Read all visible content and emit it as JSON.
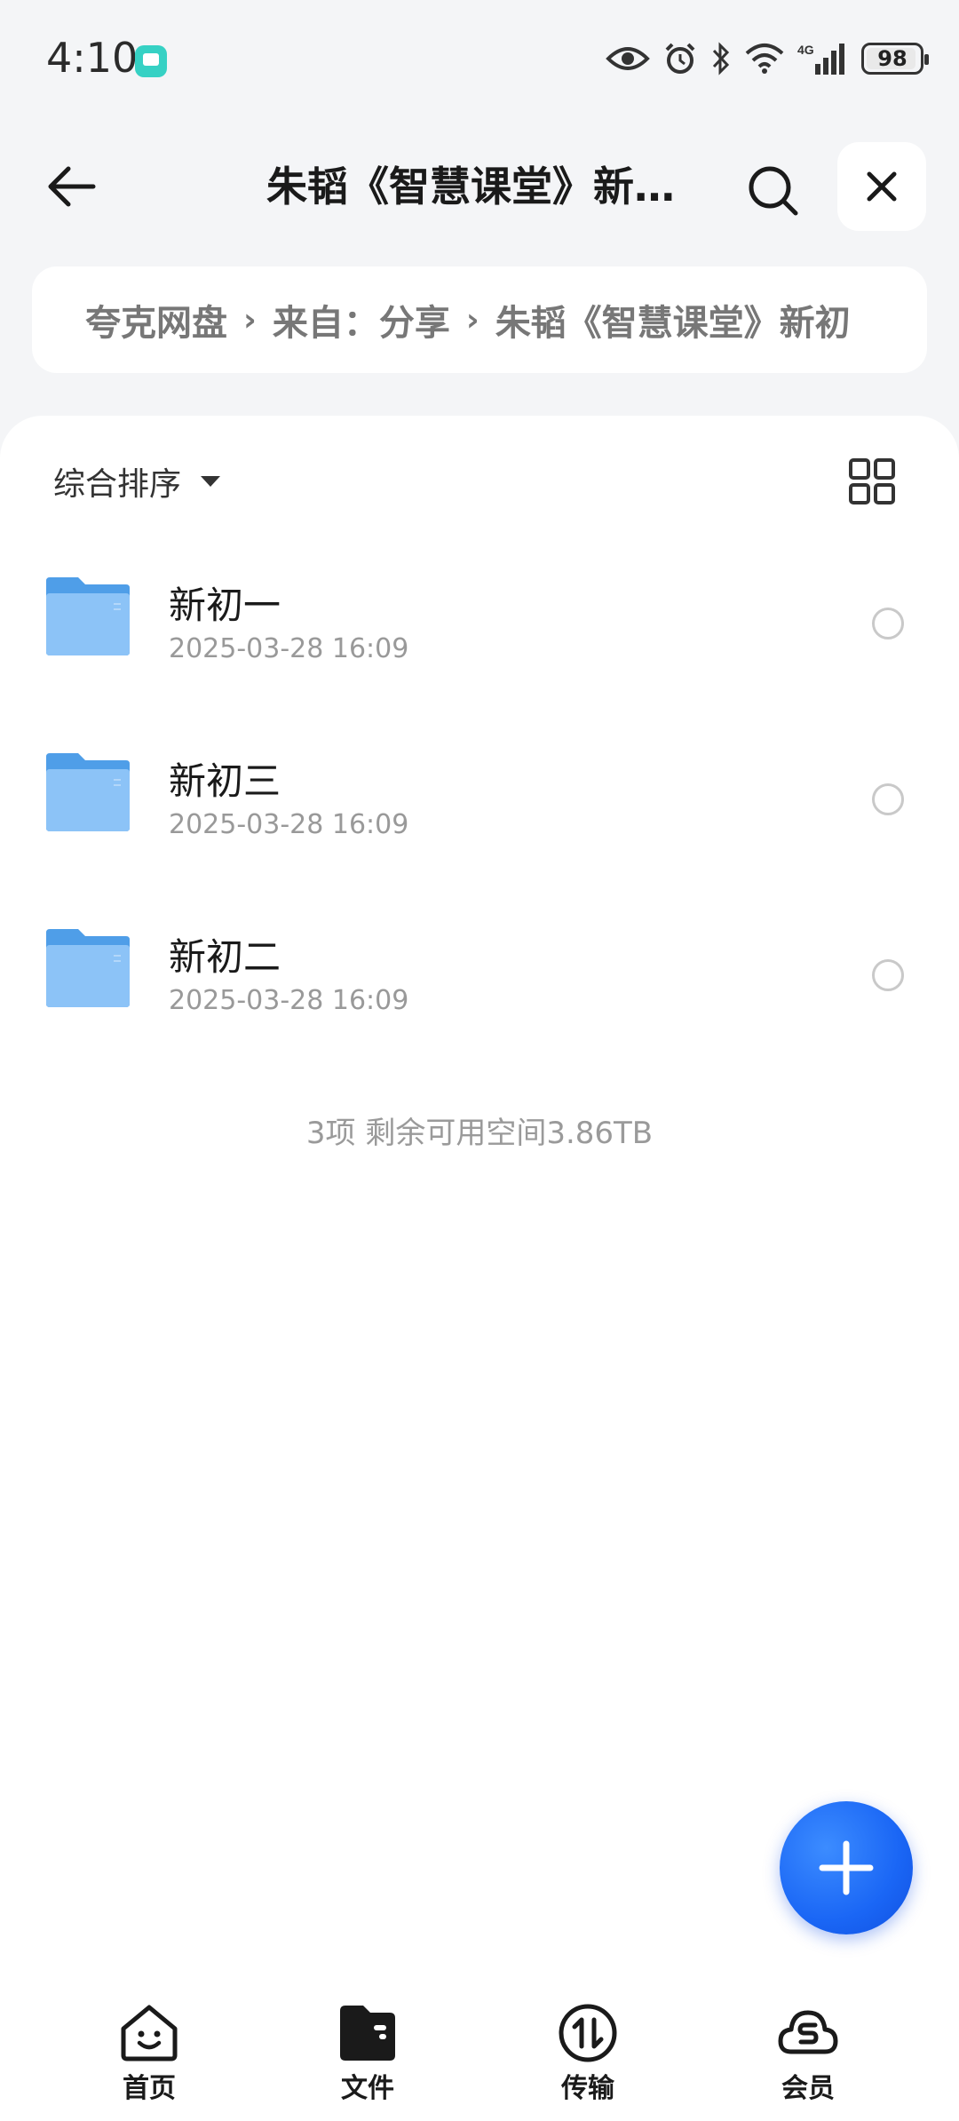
{
  "status_bar": {
    "time": "4:10",
    "battery": "98"
  },
  "header": {
    "title": "朱韬《智慧课堂》新初..."
  },
  "breadcrumb": {
    "items": [
      "夸克网盘",
      "来自：分享",
      "朱韬《智慧课堂》新初"
    ]
  },
  "toolbar": {
    "sort_label": "综合排序"
  },
  "files": [
    {
      "name": "新初一",
      "date": "2025-03-28 16:09"
    },
    {
      "name": "新初三",
      "date": "2025-03-28 16:09"
    },
    {
      "name": "新初二",
      "date": "2025-03-28 16:09"
    }
  ],
  "summary": "3项 剩余可用空间3.86TB",
  "bottom_nav": {
    "home": "首页",
    "files": "文件",
    "transfer": "传输",
    "vip": "会员"
  },
  "colors": {
    "accent": "#1a66f5",
    "folder": "#6cb2f0"
  }
}
